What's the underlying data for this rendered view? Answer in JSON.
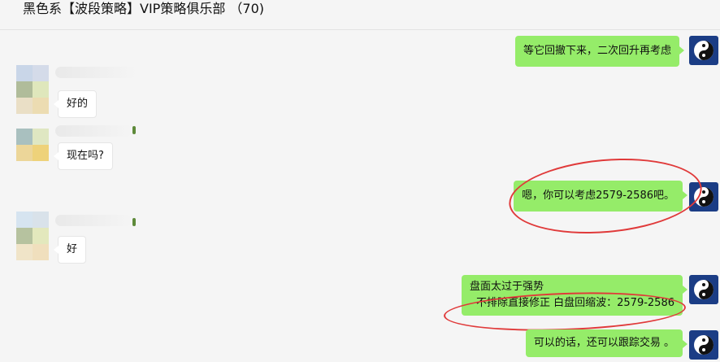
{
  "chat": {
    "title": "黑色系【波段策略】VIP策略俱乐部 （70)"
  },
  "messages": [
    {
      "sender": "me",
      "text": "等它回撤下来，二次回升再考虑"
    },
    {
      "sender": "other",
      "text": "好的"
    },
    {
      "sender": "other",
      "text": "现在吗?"
    },
    {
      "sender": "me",
      "text": "嗯，你可以考虑2579-2586吧。"
    },
    {
      "sender": "other",
      "text": "好"
    },
    {
      "sender": "me",
      "lines": [
        "盘面太过于强势",
        "不排除直接修正  白盘回缩波：2579-2586"
      ]
    },
    {
      "sender": "me",
      "text": "可以的话，还可以跟踪交易 。"
    }
  ],
  "colors": {
    "background": "#f5f5f5",
    "my_bubble": "#95ec69",
    "other_bubble": "#ffffff",
    "annotation_circle": "#e03a3a",
    "my_avatar": "#1b3d85"
  },
  "icons": {
    "my_avatar": "yin-yang-icon",
    "other_avatar": "pixelated-avatar"
  }
}
